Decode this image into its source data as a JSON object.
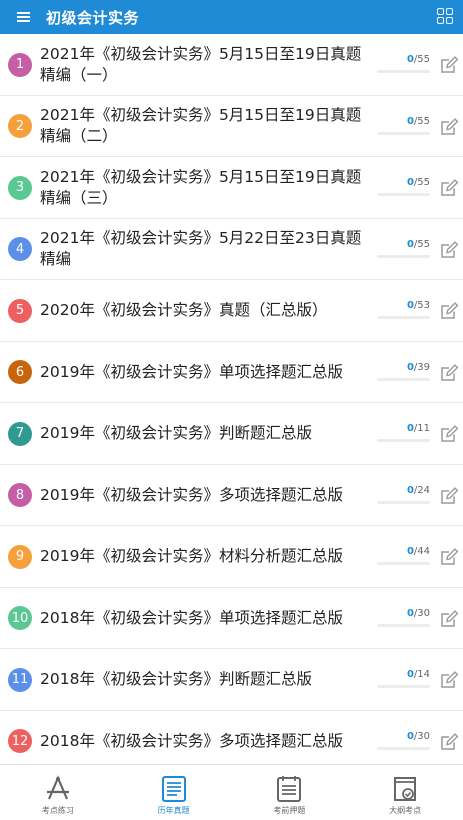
{
  "header": {
    "title": "初级会计实务"
  },
  "items": [
    {
      "index": "1",
      "title": "2021年《初级会计实务》5月15日至19日真题精编（一）",
      "done": "0",
      "total": "/55",
      "color": "#c55ea4"
    },
    {
      "index": "2",
      "title": "2021年《初级会计实务》5月15日至19日真题精编（二）",
      "done": "0",
      "total": "/55",
      "color": "#f5a03a"
    },
    {
      "index": "3",
      "title": "2021年《初级会计实务》5月15日至19日真题精编（三）",
      "done": "0",
      "total": "/55",
      "color": "#5bc792"
    },
    {
      "index": "4",
      "title": "2021年《初级会计实务》5月22日至23日真题精编",
      "done": "0",
      "total": "/55",
      "color": "#5c8fe8"
    },
    {
      "index": "5",
      "title": "2020年《初级会计实务》真题（汇总版）",
      "done": "0",
      "total": "/53",
      "color": "#ee5f5f"
    },
    {
      "index": "6",
      "title": "2019年《初级会计实务》单项选择题汇总版",
      "done": "0",
      "total": "/39",
      "color": "#c8640c"
    },
    {
      "index": "7",
      "title": "2019年《初级会计实务》判断题汇总版",
      "done": "0",
      "total": "/11",
      "color": "#2f9a8f"
    },
    {
      "index": "8",
      "title": "2019年《初级会计实务》多项选择题汇总版",
      "done": "0",
      "total": "/24",
      "color": "#c55ea4"
    },
    {
      "index": "9",
      "title": "2019年《初级会计实务》材料分析题汇总版",
      "done": "0",
      "total": "/44",
      "color": "#f5a03a"
    },
    {
      "index": "10",
      "title": "2018年《初级会计实务》单项选择题汇总版",
      "done": "0",
      "total": "/30",
      "color": "#5bc792"
    },
    {
      "index": "11",
      "title": "2018年《初级会计实务》判断题汇总版",
      "done": "0",
      "total": "/14",
      "color": "#5c8fe8"
    },
    {
      "index": "12",
      "title": "2018年《初级会计实务》多项选择题汇总版",
      "done": "0",
      "total": "/30",
      "color": "#ee5f5f"
    }
  ],
  "tabs": [
    {
      "label": "考点练习",
      "icon": "compass-ruler-icon",
      "active": false
    },
    {
      "label": "历年真题",
      "icon": "document-list-icon",
      "active": true
    },
    {
      "label": "考前押题",
      "icon": "calendar-list-icon",
      "active": false
    },
    {
      "label": "大纲考点",
      "icon": "book-check-icon",
      "active": false
    }
  ],
  "colors": {
    "primary": "#1f8ad6",
    "inactive": "#666666"
  }
}
